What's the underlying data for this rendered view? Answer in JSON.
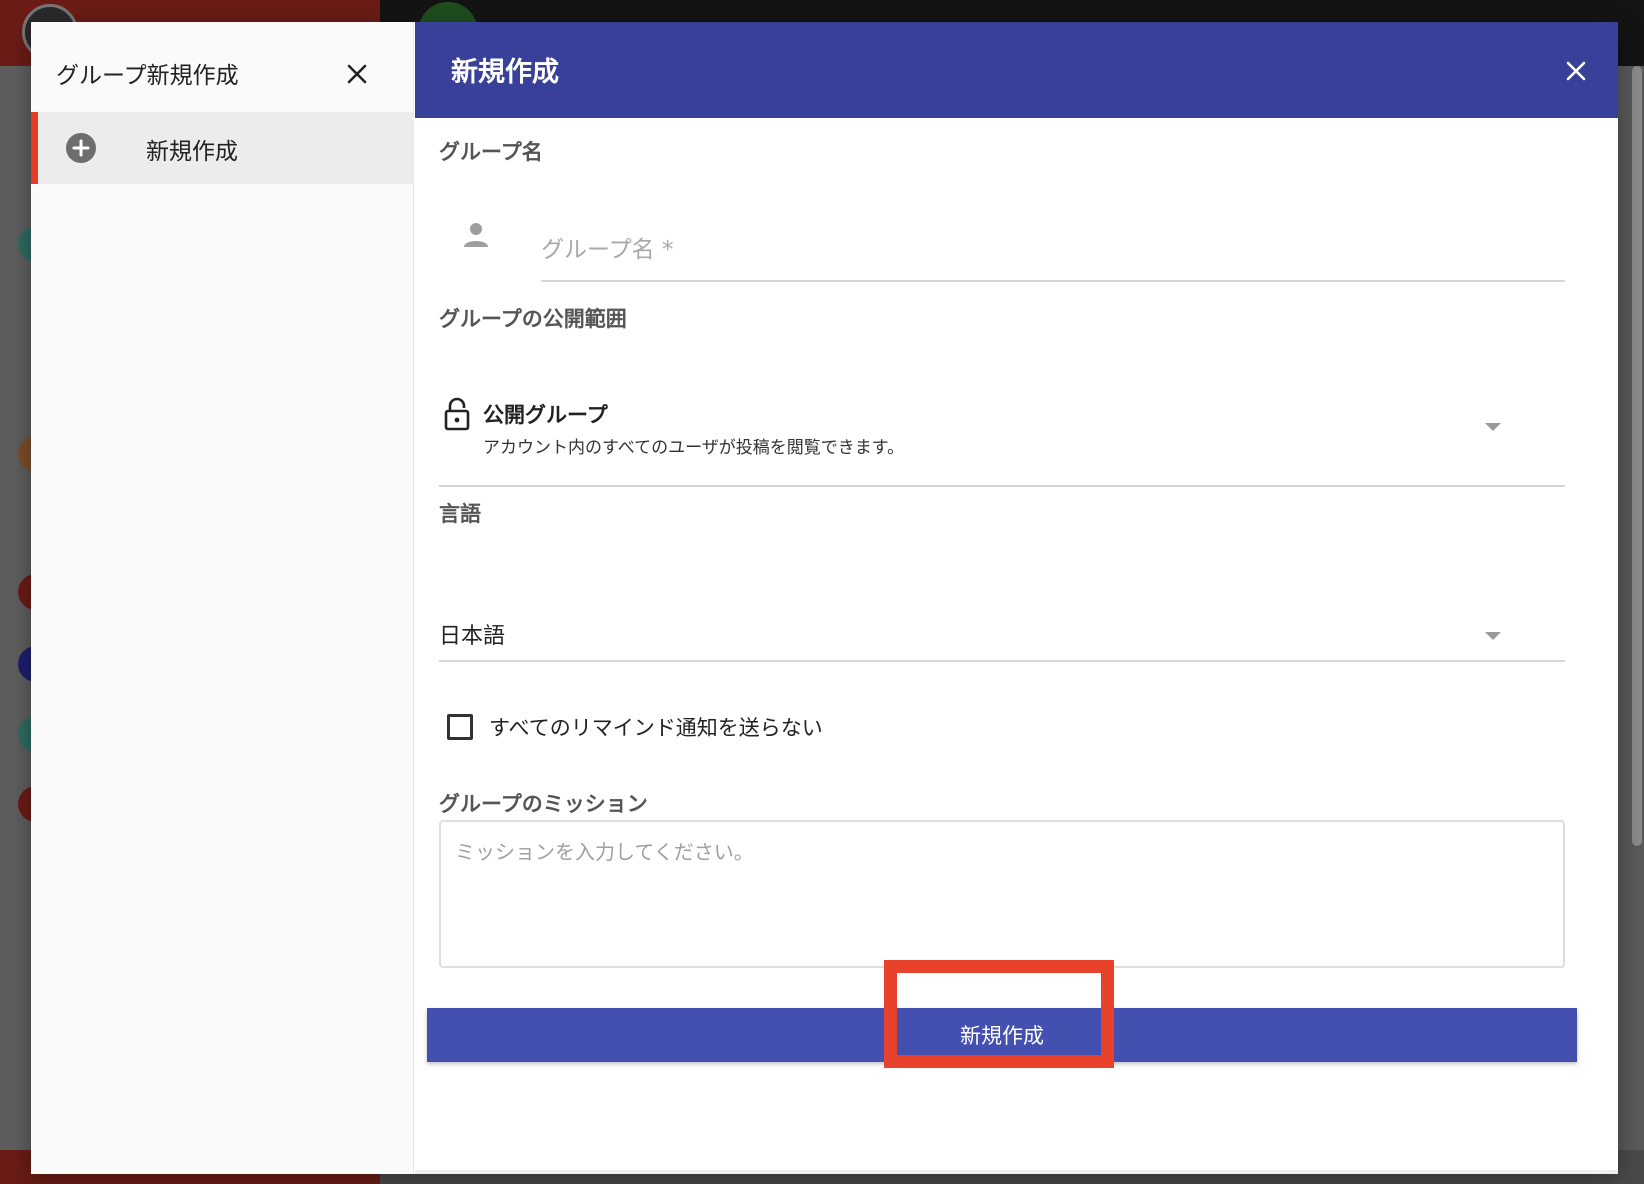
{
  "colors": {
    "header_bg": "#384099",
    "primary_button": "#4450af",
    "accent_red": "#e53c27",
    "highlight_red": "#e8412c"
  },
  "icons": {
    "left_close": "close-icon",
    "add": "plus-circle-icon",
    "header_close": "close-icon",
    "person": "person-icon",
    "lock": "lock-icon",
    "dropdown": "caret-down-icon",
    "checkbox": "checkbox-unchecked-icon"
  },
  "left_panel": {
    "title": "グループ新規作成",
    "items": [
      {
        "label": "新規作成",
        "selected": true
      }
    ]
  },
  "form": {
    "header_title": "新規作成",
    "group_name": {
      "section_label": "グループ名",
      "placeholder": "グループ名 *",
      "value": ""
    },
    "privacy": {
      "section_label": "グループの公開範囲",
      "selected_title": "公開グループ",
      "selected_description": "アカウント内のすべてのユーザが投稿を閲覧できます。"
    },
    "language": {
      "section_label": "言語",
      "selected": "日本語"
    },
    "reminder_checkbox": {
      "label": "すべてのリマインド通知を送らない",
      "checked": false
    },
    "mission": {
      "section_label": "グループのミッション",
      "placeholder": "ミッションを入力してください。",
      "value": ""
    },
    "submit_label": "新規作成"
  }
}
